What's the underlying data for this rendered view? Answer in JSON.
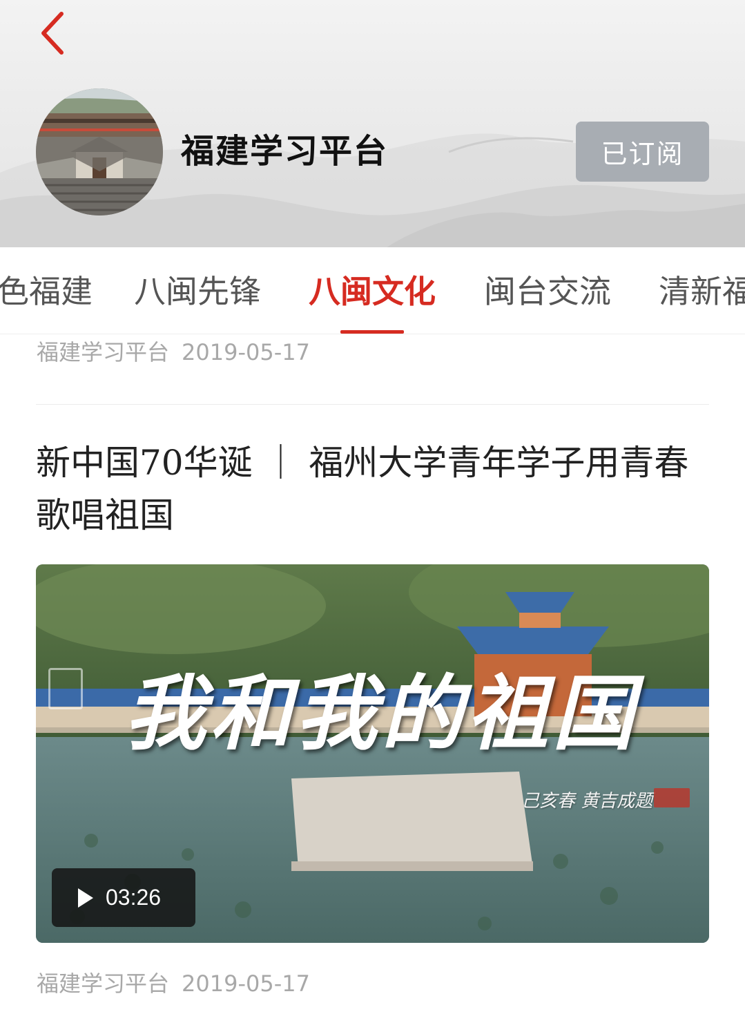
{
  "header": {
    "channel_name": "福建学习平台",
    "subscribe_label": "已订阅"
  },
  "tabs": [
    {
      "label": "色福建"
    },
    {
      "label": "八闽先锋"
    },
    {
      "label": "八闽文化",
      "active": true
    },
    {
      "label": "闽台交流"
    },
    {
      "label": "清新福"
    }
  ],
  "prev_item": {
    "source": "福建学习平台",
    "date": "2019-05-17"
  },
  "article": {
    "title": "新中国70华诞 ｜ 福州大学青年学子用青春歌唱祖国",
    "video": {
      "overlay_title": "我和我的祖国",
      "signature": "己亥春 黄吉成题",
      "duration": "03:26"
    },
    "source": "福建学习平台",
    "date": "2019-05-17"
  },
  "colors": {
    "accent": "#d62b21",
    "subscribed_button": "#a8adb3",
    "meta_text": "#a8a8a8"
  },
  "icons": {
    "back": "chevron-left-icon",
    "play": "play-icon"
  }
}
